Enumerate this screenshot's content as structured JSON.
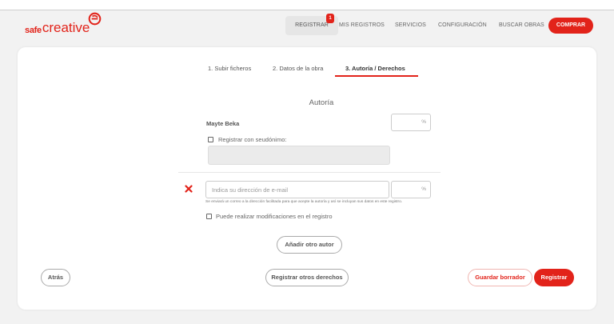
{
  "brand": {
    "logo_safe": "safe",
    "logo_creative": "creative",
    "accent_color": "#e2231a"
  },
  "nav": {
    "registrar": "REGISTRAR",
    "registrar_badge": "1",
    "mis_registros": "MIS REGISTROS",
    "servicios": "SERVICIOS",
    "configuracion": "CONFIGURACIÓN",
    "buscar_obras": "BUSCAR OBRAS",
    "comprar": "COMPRAR"
  },
  "steps": [
    {
      "label": "1. Subir ficheros",
      "active": false
    },
    {
      "label": "2. Datos de la obra",
      "active": false
    },
    {
      "label": "3. Autoría / Derechos",
      "active": true
    }
  ],
  "section": {
    "title": "Autoría"
  },
  "author1": {
    "name": "Mayte Beka",
    "percent_symbol": "%",
    "pseudonym_label": "Registrar con seudónimo:",
    "pseudonym_checked": false,
    "pseudonym_value": ""
  },
  "author2": {
    "email_placeholder": "Indica su dirección de e-mail",
    "email_value": "",
    "percent_symbol": "%",
    "help_text": "Se enviará un correo a la dirección facilitada para que acepte la autoría y así se incluyan sus datos en este registro.",
    "can_modify_label": "Puede realizar modificaciones en el registro",
    "can_modify_checked": false,
    "remove_icon": "close-x-icon"
  },
  "buttons": {
    "add_author": "Añadir otro autor",
    "back": "Atrás",
    "register_other_rights": "Registrar otros derechos",
    "save_draft": "Guardar borrador",
    "register": "Registrar"
  }
}
